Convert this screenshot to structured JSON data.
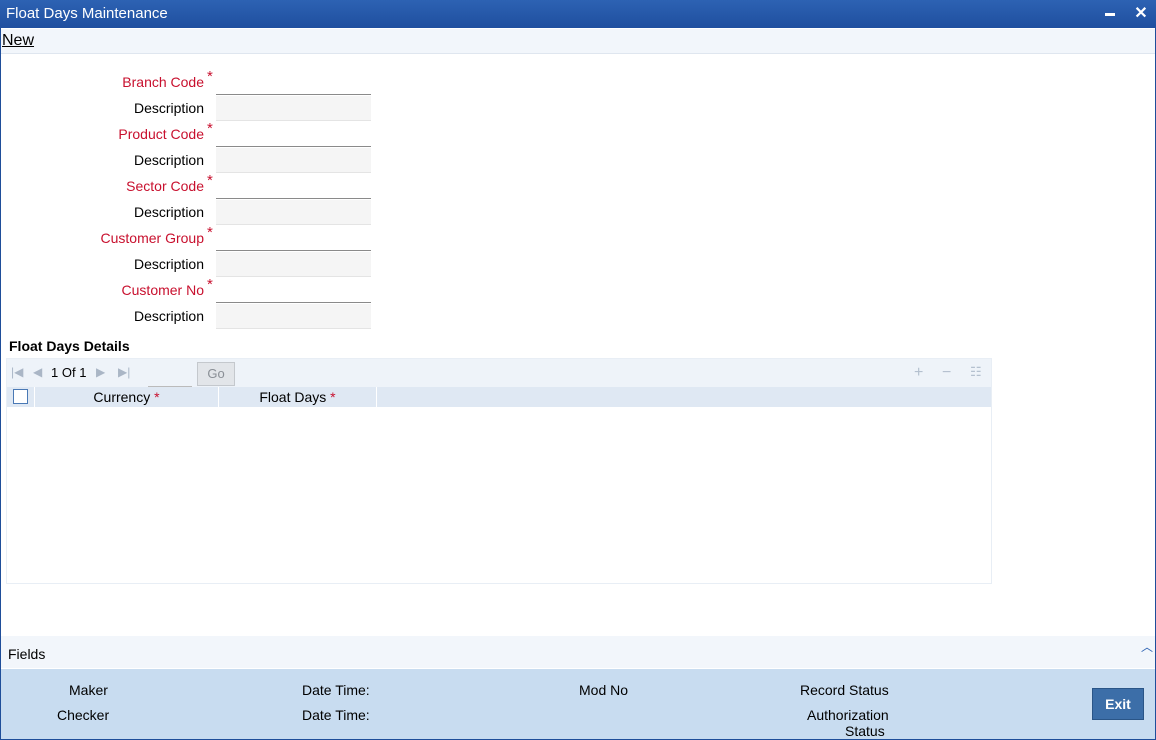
{
  "window": {
    "title": "Float Days Maintenance",
    "minimize_glyph": "▬",
    "close_glyph": "✕"
  },
  "menu": {
    "new_label": "New"
  },
  "form": {
    "branch_code_label": "Branch Code",
    "description_label": "Description",
    "product_code_label": "Product Code",
    "sector_code_label": "Sector Code",
    "customer_group_label": "Customer Group",
    "customer_no_label": "Customer No",
    "required_mark": "*"
  },
  "details": {
    "section_title": "Float Days Details",
    "page_current": "1",
    "page_of": "Of",
    "page_total": "1",
    "go_label": "Go",
    "columns": [
      "Currency",
      "Float Days"
    ]
  },
  "fields_bar": {
    "label": "Fields"
  },
  "footer": {
    "maker_label": "Maker",
    "checker_label": "Checker",
    "date_time_label": "Date Time:",
    "mod_no_label": "Mod No",
    "record_status_label": "Record Status",
    "authorization_label": "Authorization",
    "status_label": "Status",
    "exit_label": "Exit"
  },
  "colors": {
    "title_bar": "#2d62b3",
    "required": "#c8102e",
    "footer_bg": "#c8dcf0",
    "exit_button": "#3c6ea8"
  }
}
